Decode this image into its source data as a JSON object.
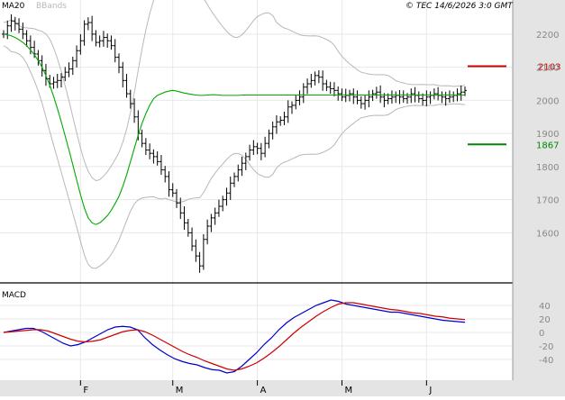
{
  "header": {
    "ma_label": "MA20",
    "bb_label": "BBands",
    "copyright": "© TEC 14/6/2026 3:0 GMT"
  },
  "colors": {
    "price": "#000000",
    "ma": "#00aa00",
    "bbands": "#b8b8b8",
    "macd": "#0000cc",
    "signal": "#cc0000",
    "resistance": "#cc0000",
    "support": "#008800",
    "grid": "#e8e8e8",
    "axis_bg": "#e4e4e4"
  },
  "chart_data": [
    {
      "type": "candlestick",
      "title": "",
      "xlabel": "",
      "ylabel": "",
      "ylim": [
        1465,
        2265
      ],
      "y_ticks": [
        1600,
        1700,
        1800,
        1900,
        2000,
        2100,
        2200
      ],
      "x_month_ticks": [
        {
          "label": "F",
          "i": 20
        },
        {
          "label": "M",
          "i": 44
        },
        {
          "label": "A",
          "i": 66
        },
        {
          "label": "M",
          "i": 88
        },
        {
          "label": "J",
          "i": 110
        }
      ],
      "n_points": 121,
      "close": [
        2200,
        2225,
        2240,
        2232,
        2215,
        2200,
        2180,
        2160,
        2140,
        2120,
        2090,
        2065,
        2050,
        2055,
        2060,
        2070,
        2085,
        2095,
        2120,
        2150,
        2180,
        2230,
        2235,
        2200,
        2175,
        2180,
        2190,
        2180,
        2165,
        2130,
        2100,
        2060,
        2020,
        1990,
        1950,
        1900,
        1870,
        1850,
        1840,
        1830,
        1815,
        1790,
        1770,
        1730,
        1720,
        1690,
        1660,
        1630,
        1600,
        1560,
        1530,
        1500,
        1580,
        1620,
        1645,
        1660,
        1680,
        1700,
        1720,
        1750,
        1770,
        1790,
        1810,
        1830,
        1850,
        1860,
        1855,
        1840,
        1870,
        1900,
        1920,
        1935,
        1940,
        1950,
        1980,
        1985,
        2000,
        2010,
        2040,
        2050,
        2060,
        2075,
        2070,
        2050,
        2040,
        2035,
        2030,
        2020,
        2010,
        2015,
        2020,
        2010,
        2000,
        1990,
        2000,
        2010,
        2020,
        2025,
        2010,
        2000,
        2005,
        2010,
        2015,
        2010,
        2005,
        2010,
        2020,
        2015,
        2005,
        2000,
        2010,
        2015,
        2020,
        2015,
        2010,
        2005,
        2010,
        2015,
        2020,
        2025,
        2030
      ],
      "ma20": [
        2200,
        2198,
        2195,
        2190,
        2183,
        2175,
        2165,
        2152,
        2138,
        2120,
        2100,
        2075,
        2046,
        2012,
        1975,
        1935,
        1893,
        1850,
        1805,
        1760,
        1715,
        1675,
        1645,
        1630,
        1625,
        1630,
        1640,
        1652,
        1668,
        1688,
        1710,
        1740,
        1775,
        1815,
        1855,
        1895,
        1930,
        1960,
        1985,
        2005,
        2015,
        2020,
        2025,
        2028,
        2030,
        2028,
        2025,
        2022,
        2020,
        2018,
        2016,
        2015,
        2015,
        2016,
        2017,
        2017,
        2016,
        2015,
        2015,
        2015,
        2015,
        2015,
        2016,
        2016,
        2016,
        2016,
        2016,
        2016,
        2016,
        2016,
        2016,
        2016,
        2016,
        2016,
        2016,
        2016,
        2016,
        2016,
        2016,
        2016,
        2016,
        2016,
        2016,
        2016,
        2016,
        2016,
        2016,
        2016,
        2016,
        2016,
        2016,
        2016,
        2016,
        2016,
        2016,
        2016,
        2016,
        2016,
        2016,
        2016,
        2016,
        2016,
        2016,
        2016,
        2016,
        2016,
        2016,
        2016,
        2016,
        2016,
        2016,
        2016,
        2016,
        2016,
        2016,
        2016,
        2016,
        2016,
        2016,
        2016,
        2016
      ],
      "resistance": {
        "label": "2103",
        "value": 2103
      },
      "support": {
        "label": "1867",
        "value": 1867
      }
    },
    {
      "type": "line",
      "title": "MACD",
      "ylim": [
        -60,
        60
      ],
      "y_ticks": [
        {
          "label": "40",
          "value": 40
        },
        {
          "label": "20",
          "value": 20
        },
        {
          "label": "0",
          "value": 0
        },
        {
          "label": "-20",
          "value": -20
        },
        {
          "label": "-40",
          "value": -40
        }
      ],
      "series": [
        {
          "key": "macd",
          "values": [
            0,
            2,
            4,
            6,
            6,
            2,
            -4,
            -10,
            -16,
            -20,
            -18,
            -14,
            -8,
            -2,
            4,
            8,
            9,
            8,
            4,
            -8,
            -18,
            -26,
            -33,
            -39,
            -43,
            -46,
            -48,
            -52,
            -55,
            -56,
            -60,
            -58,
            -50,
            -40,
            -30,
            -18,
            -8,
            4,
            14,
            22,
            28,
            34,
            40,
            44,
            48,
            46,
            42,
            40,
            38,
            36,
            34,
            32,
            30,
            30,
            28,
            26,
            24,
            22,
            20,
            18,
            17,
            16,
            15
          ]
        },
        {
          "key": "signal",
          "values": [
            0,
            1,
            2,
            3,
            4,
            4,
            2,
            -2,
            -6,
            -10,
            -13,
            -14,
            -13,
            -11,
            -7,
            -3,
            1,
            3,
            4,
            1,
            -4,
            -10,
            -16,
            -22,
            -28,
            -33,
            -37,
            -42,
            -46,
            -50,
            -54,
            -56,
            -54,
            -50,
            -45,
            -38,
            -30,
            -21,
            -11,
            -1,
            8,
            16,
            24,
            31,
            37,
            42,
            44,
            44,
            42,
            40,
            38,
            36,
            34,
            33,
            31,
            29,
            28,
            26,
            24,
            23,
            21,
            20,
            19
          ]
        }
      ]
    }
  ]
}
